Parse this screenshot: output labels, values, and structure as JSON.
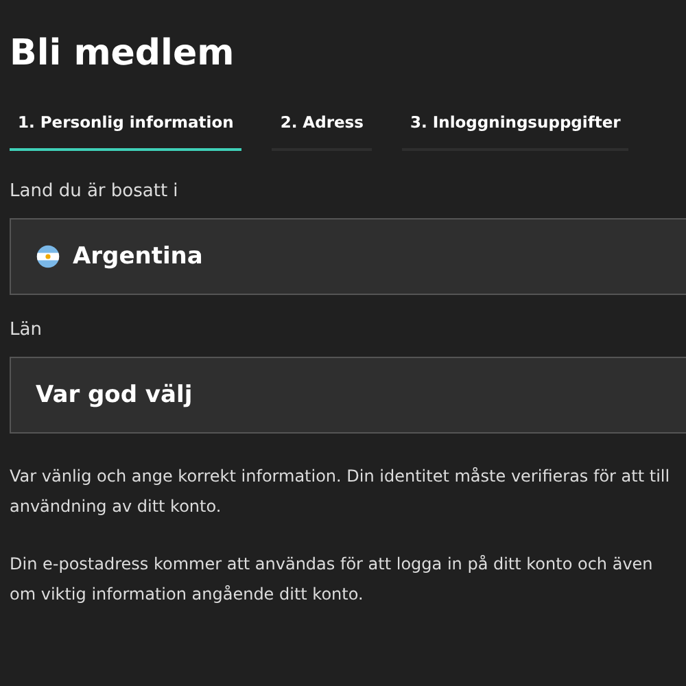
{
  "title": "Bli medlem",
  "tabs": [
    {
      "label": "1. Personlig information",
      "selected": true
    },
    {
      "label": "2. Adress",
      "selected": false
    },
    {
      "label": "3. Inloggningsuppgifter",
      "selected": false
    }
  ],
  "fields": [
    {
      "label": "Land du är bosatt i",
      "value": "Argentina",
      "flag": true
    },
    {
      "label": "Län",
      "value": "Var god välj",
      "flag": false
    }
  ],
  "paragraphs": [
    [
      "Var vänlig och ange korrekt information. Din identitet måste verifieras för att till",
      "användning av ditt konto."
    ],
    [
      "Din e-postadress kommer att användas för att logga in på ditt konto och även",
      "om viktig information angående ditt konto."
    ]
  ]
}
